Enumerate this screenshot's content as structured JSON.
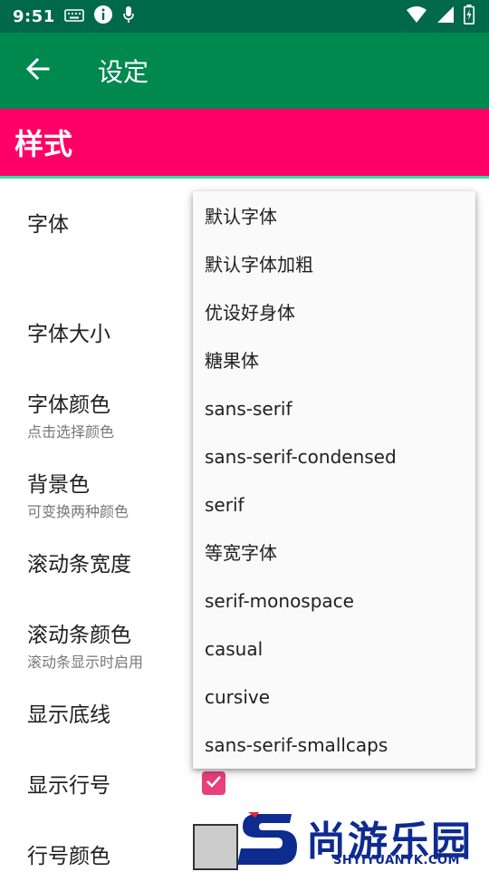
{
  "status_bar": {
    "time": "9:51",
    "icons": [
      "keyboard-icon",
      "info-icon",
      "microphone-icon",
      "wifi-icon",
      "signal-icon",
      "battery-charging-icon"
    ]
  },
  "app_bar": {
    "title": "设定",
    "back_icon": "arrow-back-icon",
    "color": "#00894f"
  },
  "section": {
    "title": "样式",
    "color": "#ff0066",
    "accent": "#31e2a6"
  },
  "preferences": [
    {
      "title": "字体",
      "summary": ""
    },
    {
      "title": "字体大小",
      "summary": ""
    },
    {
      "title": "字体颜色",
      "summary": "点击选择颜色"
    },
    {
      "title": "背景色",
      "summary": "可变换两种颜色"
    },
    {
      "title": "滚动条宽度",
      "summary": ""
    },
    {
      "title": "滚动条颜色",
      "summary": "滚动条显示时启用"
    },
    {
      "title": "显示底线",
      "summary": ""
    },
    {
      "title": "显示行号",
      "summary": ""
    },
    {
      "title": "行号颜色",
      "summary": ""
    }
  ],
  "show_line_number_checked": true,
  "line_number_color": "#cccccc",
  "font_dropdown": {
    "options": [
      "默认字体",
      "默认字体加粗",
      "优设好身体",
      "糖果体",
      "sans-serif",
      "sans-serif-condensed",
      "serif",
      "等宽字体",
      "serif-monospace",
      "casual",
      "cursive",
      "sans-serif-smallcaps"
    ]
  },
  "watermark": {
    "name": "尚游乐园",
    "url": "SHYIYUANYK.COM"
  }
}
